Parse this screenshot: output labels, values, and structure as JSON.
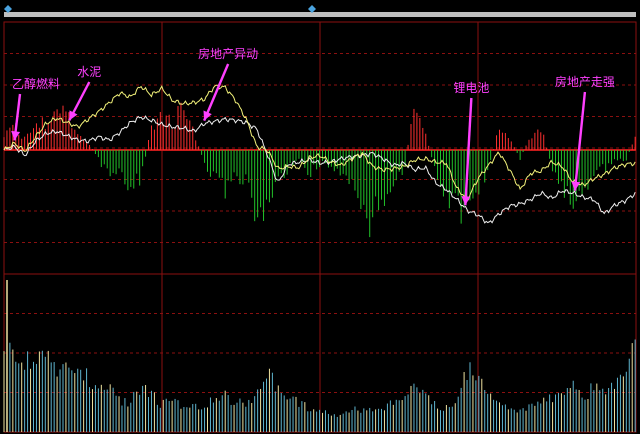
{
  "colors": {
    "background": "#000000",
    "grid": "#8b1010",
    "zero_line": "#c81a1a",
    "price_line": "#f0f0f0",
    "avg_line": "#f2f27a",
    "up_bar": "#ff3030",
    "down_bar": "#22c22a",
    "volume_bar": "#5fb6d0",
    "volume_bar_alt": "#f0e3a0",
    "annotation": "#ff40ff",
    "scrollbar": "#bfbfbf",
    "scroll_marker": "#4aa3df"
  },
  "annotations": [
    {
      "label": "乙醇燃料",
      "at_minute": 5
    },
    {
      "label": "水泥",
      "at_minute": 31
    },
    {
      "label": "房地产异动",
      "at_minute": 95
    },
    {
      "label": "锂电池",
      "at_minute": 219
    },
    {
      "label": "房地产走强",
      "at_minute": 271
    }
  ],
  "chart_data": [
    {
      "type": "line",
      "panel": "intraday-price",
      "x_unit": "minute",
      "xlim": [
        0,
        300
      ],
      "ylim": [
        -100,
        100
      ],
      "grid": true,
      "series": [
        {
          "role": "price",
          "x": [
            0,
            5,
            10,
            15,
            20,
            25,
            30,
            35,
            40,
            45,
            50,
            55,
            60,
            65,
            70,
            75,
            80,
            85,
            90,
            95,
            100,
            105,
            110,
            115,
            120,
            125,
            130,
            135,
            140,
            145,
            150,
            155,
            160,
            165,
            170,
            175,
            180,
            185,
            190,
            195,
            200,
            205,
            210,
            215,
            220,
            225,
            230,
            235,
            240,
            245,
            250,
            255,
            260,
            265,
            270,
            275,
            280,
            285,
            290,
            295,
            300
          ],
          "values": [
            0,
            3,
            -5,
            8,
            15,
            17,
            13,
            9,
            8,
            12,
            9,
            16,
            25,
            30,
            27,
            23,
            21,
            20,
            17,
            24,
            26,
            28,
            27,
            25,
            19,
            -4,
            -30,
            -13,
            -11,
            -9,
            -12,
            -11,
            -8,
            -6,
            -5,
            -3,
            -8,
            -14,
            -12,
            -18,
            -16,
            -30,
            -36,
            -45,
            -55,
            -59,
            -67,
            -58,
            -51,
            -49,
            -45,
            -39,
            -44,
            -37,
            -39,
            -43,
            -45,
            -58,
            -50,
            -46,
            -39
          ]
        },
        {
          "role": "average",
          "x": [
            0,
            5,
            10,
            15,
            20,
            25,
            30,
            35,
            40,
            45,
            50,
            55,
            60,
            65,
            70,
            75,
            80,
            85,
            90,
            95,
            100,
            105,
            110,
            115,
            120,
            125,
            130,
            135,
            140,
            145,
            150,
            155,
            160,
            165,
            170,
            175,
            180,
            185,
            190,
            195,
            200,
            205,
            210,
            215,
            220,
            225,
            230,
            235,
            240,
            245,
            250,
            255,
            260,
            265,
            270,
            275,
            280,
            285,
            290,
            295,
            300
          ],
          "values": [
            0,
            6,
            -1,
            12,
            24,
            29,
            25,
            21,
            28,
            35,
            43,
            52,
            48,
            58,
            50,
            56,
            45,
            42,
            43,
            46,
            58,
            57,
            45,
            28,
            3,
            0,
            -17,
            -15,
            -16,
            -7,
            -5,
            -11,
            -14,
            -8,
            -3,
            -15,
            -18,
            -17,
            -15,
            -9,
            -8,
            -11,
            -12,
            -35,
            -45,
            -26,
            -14,
            -2,
            -18,
            -36,
            -21,
            -19,
            -11,
            -15,
            -29,
            -32,
            -26,
            -22,
            -16,
            -13,
            -12
          ]
        },
        {
          "role": "breadth-bars",
          "x": [
            0,
            5,
            10,
            15,
            20,
            25,
            30,
            35,
            40,
            45,
            50,
            55,
            60,
            65,
            70,
            75,
            80,
            85,
            90,
            95,
            100,
            105,
            110,
            115,
            120,
            125,
            130,
            135,
            140,
            145,
            150,
            155,
            160,
            165,
            170,
            175,
            180,
            185,
            190,
            195,
            200,
            205,
            210,
            215,
            220,
            225,
            230,
            235,
            240,
            245,
            250,
            255,
            260,
            265,
            270,
            275,
            280,
            285,
            290,
            295,
            300
          ],
          "values": [
            12,
            15,
            8,
            20,
            16,
            22,
            26,
            10,
            5,
            -6,
            -18,
            -12,
            -24,
            -20,
            15,
            22,
            18,
            27,
            12,
            -8,
            -18,
            -26,
            -15,
            -22,
            -40,
            -44,
            -18,
            -12,
            -6,
            -15,
            -9,
            -12,
            -14,
            -25,
            -36,
            -48,
            -30,
            -20,
            -12,
            32,
            10,
            -14,
            -30,
            -38,
            -42,
            -25,
            -12,
            14,
            8,
            -6,
            10,
            16,
            -12,
            -22,
            -35,
            -28,
            -16,
            -12,
            -6,
            -8,
            10
          ]
        }
      ]
    },
    {
      "type": "bar",
      "panel": "volume",
      "x_unit": "minute",
      "xlim": [
        0,
        300
      ],
      "ylim": [
        0,
        100
      ],
      "grid": true,
      "series": [
        {
          "role": "volume",
          "x": [
            0,
            5,
            10,
            15,
            20,
            25,
            30,
            35,
            40,
            45,
            50,
            55,
            60,
            65,
            70,
            75,
            80,
            85,
            90,
            95,
            100,
            105,
            110,
            115,
            120,
            125,
            130,
            135,
            140,
            145,
            150,
            155,
            160,
            165,
            170,
            175,
            180,
            185,
            190,
            195,
            200,
            205,
            210,
            215,
            220,
            225,
            230,
            235,
            240,
            245,
            250,
            255,
            260,
            265,
            270,
            275,
            280,
            285,
            290,
            295,
            300
          ],
          "values": [
            62,
            55,
            48,
            46,
            50,
            44,
            45,
            42,
            36,
            30,
            28,
            22,
            20,
            30,
            26,
            18,
            22,
            17,
            16,
            18,
            22,
            24,
            20,
            18,
            28,
            38,
            30,
            22,
            20,
            16,
            14,
            12,
            12,
            14,
            16,
            13,
            15,
            20,
            24,
            30,
            24,
            18,
            16,
            22,
            42,
            34,
            26,
            20,
            16,
            16,
            18,
            20,
            22,
            26,
            32,
            24,
            30,
            28,
            34,
            42,
            62
          ]
        }
      ]
    }
  ]
}
